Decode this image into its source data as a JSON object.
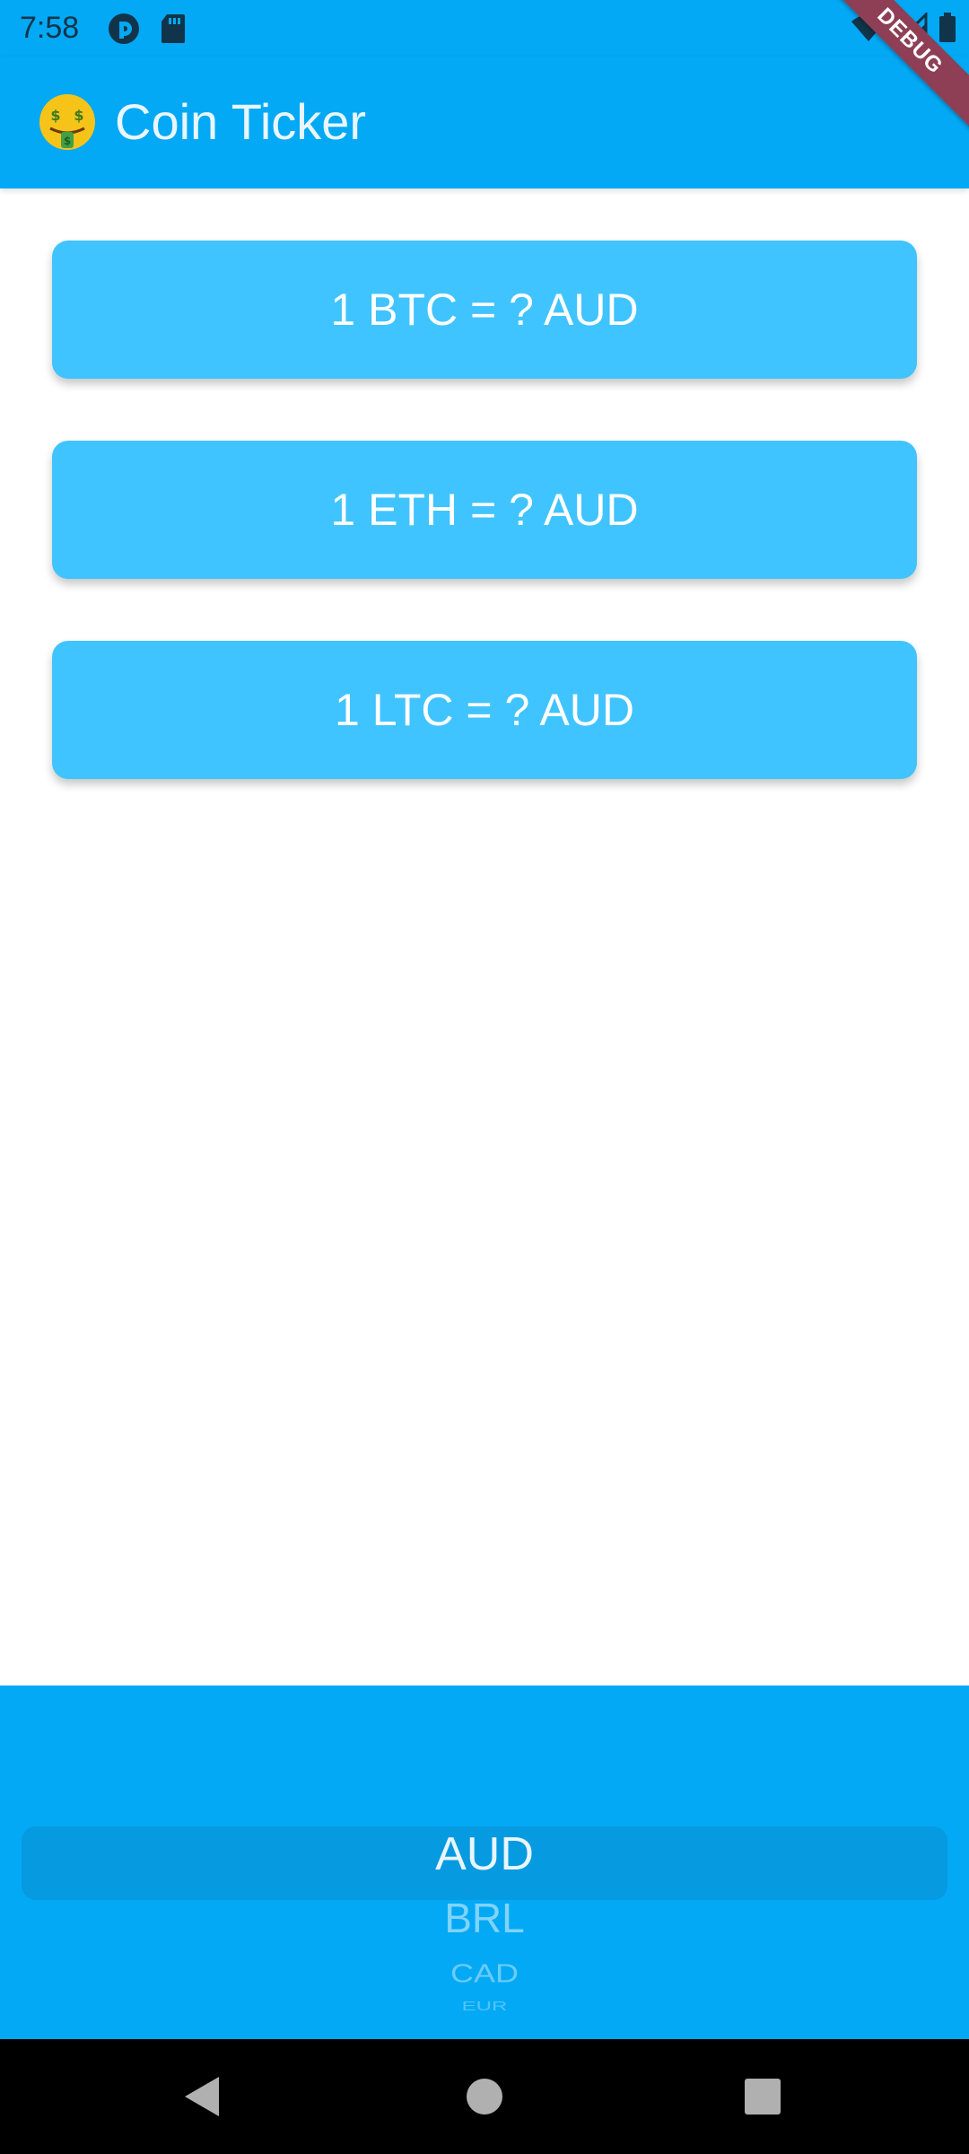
{
  "status_bar": {
    "time": "7:58",
    "left_icons": [
      "pocket-casts-icon",
      "sd-card-icon"
    ],
    "right_icons": [
      "wifi-icon",
      "cell-signal-icon",
      "battery-icon"
    ]
  },
  "app_bar": {
    "emoji_icon": "money-mouth-face-icon",
    "title": "Coin Ticker",
    "debug_label": "DEBUG",
    "color": "#03a9f4"
  },
  "cards": [
    {
      "label": "1 BTC = ? AUD"
    },
    {
      "label": "1 ETH = ? AUD"
    },
    {
      "label": "1 LTC = ? AUD"
    }
  ],
  "picker": {
    "selected": "AUD",
    "visible_options": [
      "AUD",
      "BRL",
      "CAD",
      "EUR"
    ]
  },
  "nav_bar": {
    "buttons": [
      "back-icon",
      "home-icon",
      "recents-icon"
    ]
  },
  "colors": {
    "primary": "#03a9f4",
    "card": "#40c4ff",
    "debug": "#8e3f56"
  }
}
